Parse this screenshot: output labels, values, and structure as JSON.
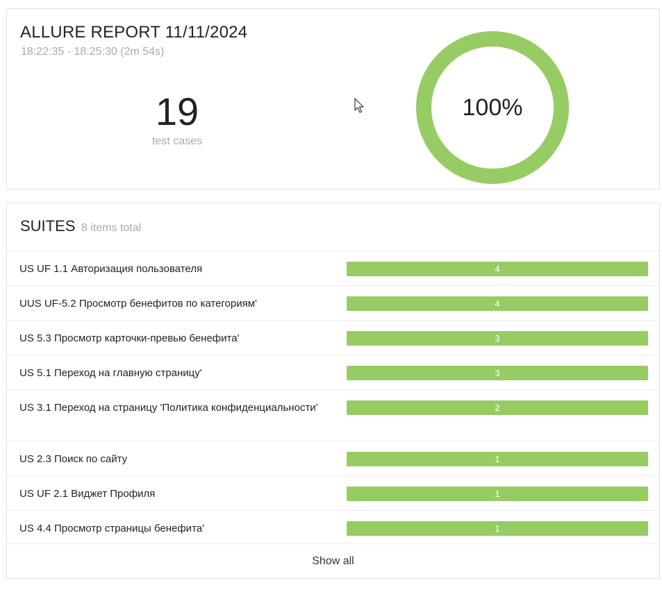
{
  "summary": {
    "title": "ALLURE REPORT 11/11/2024",
    "time_range": "18:22:35 - 18:25:30 (2m 54s)",
    "test_cases_count": "19",
    "test_cases_label": "test cases",
    "pass_rate_label": "100%",
    "pass_rate": 1.0,
    "pass_color": "#97cc64"
  },
  "suites": {
    "title": "SUITES",
    "total_label": "8 items total",
    "bar_color": "#97cc64",
    "items": [
      {
        "name": "US UF 1.1 Авторизация пользователя",
        "count": "4",
        "passed_fraction": 1.0
      },
      {
        "name": "UUS UF-5.2 Просмотр бенефитов по категориям'",
        "count": "4",
        "passed_fraction": 1.0
      },
      {
        "name": "US 5.3 Просмотр карточки-превью бенефита'",
        "count": "3",
        "passed_fraction": 1.0
      },
      {
        "name": "US 5.1 Переход на главную страницу'",
        "count": "3",
        "passed_fraction": 1.0
      },
      {
        "name": "US 3.1 Переход на страницу 'Политика конфиденциальности'",
        "count": "2",
        "passed_fraction": 1.0
      },
      {
        "name": "US 2.3 Поиск по сайту",
        "count": "1",
        "passed_fraction": 1.0
      },
      {
        "name": "US UF 2.1 Виджет Профиля",
        "count": "1",
        "passed_fraction": 1.0
      },
      {
        "name": "US 4.4 Просмотр страницы бенефита'",
        "count": "1",
        "passed_fraction": 1.0
      }
    ],
    "show_all_label": "Show all"
  },
  "icons": {
    "cursor": "mouse-pointer-icon"
  }
}
